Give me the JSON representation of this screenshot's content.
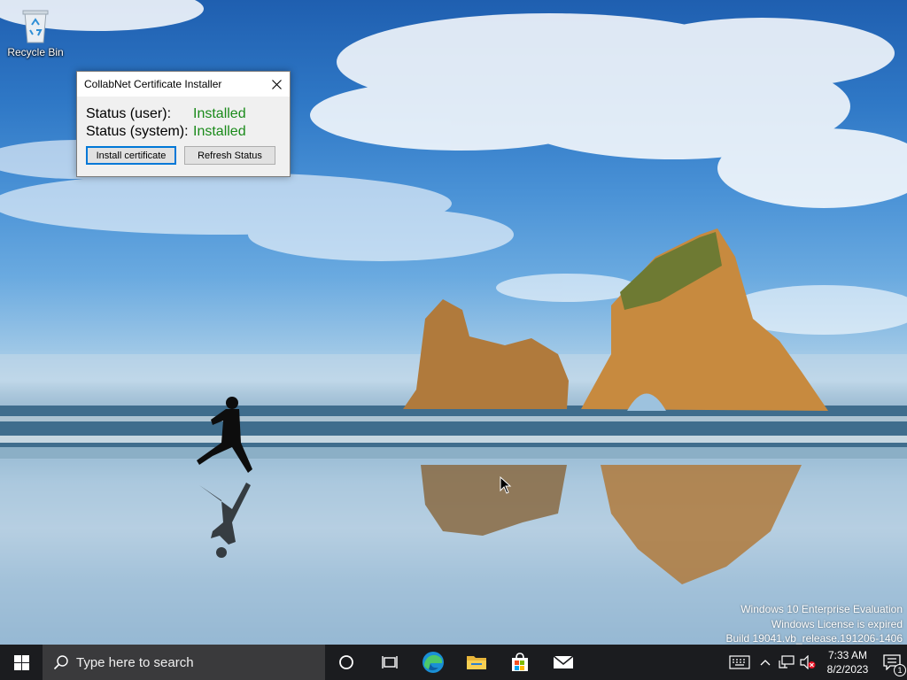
{
  "desktop": {
    "recycle_bin_label": "Recycle Bin"
  },
  "dialog": {
    "title": "CollabNet Certificate Installer",
    "close_glyph": "✕",
    "status_user_label": "Status (user):",
    "status_user_value": "Installed",
    "status_system_label": "Status (system):",
    "status_system_value": "Installed",
    "install_button_label": "Install certificate",
    "refresh_button_label": "Refresh Status",
    "status_color": "#1a8a1a"
  },
  "watermark": {
    "line1": "Windows 10 Enterprise Evaluation",
    "line2": "Windows License is expired",
    "line3": "Build 19041.vb_release.191206-1406"
  },
  "taskbar": {
    "search_placeholder": "Type here to search",
    "pinned_apps": [
      "cortana-icon",
      "task-view-icon",
      "edge-icon",
      "file-explorer-icon",
      "store-icon",
      "mail-icon"
    ],
    "tray_icons": [
      "keyboard-icon",
      "chevron-up-icon",
      "network-icon",
      "volume-muted-icon"
    ],
    "time": "7:33 AM",
    "date": "8/2/2023",
    "notification_count": "1",
    "accent_color": "#0078d7"
  }
}
